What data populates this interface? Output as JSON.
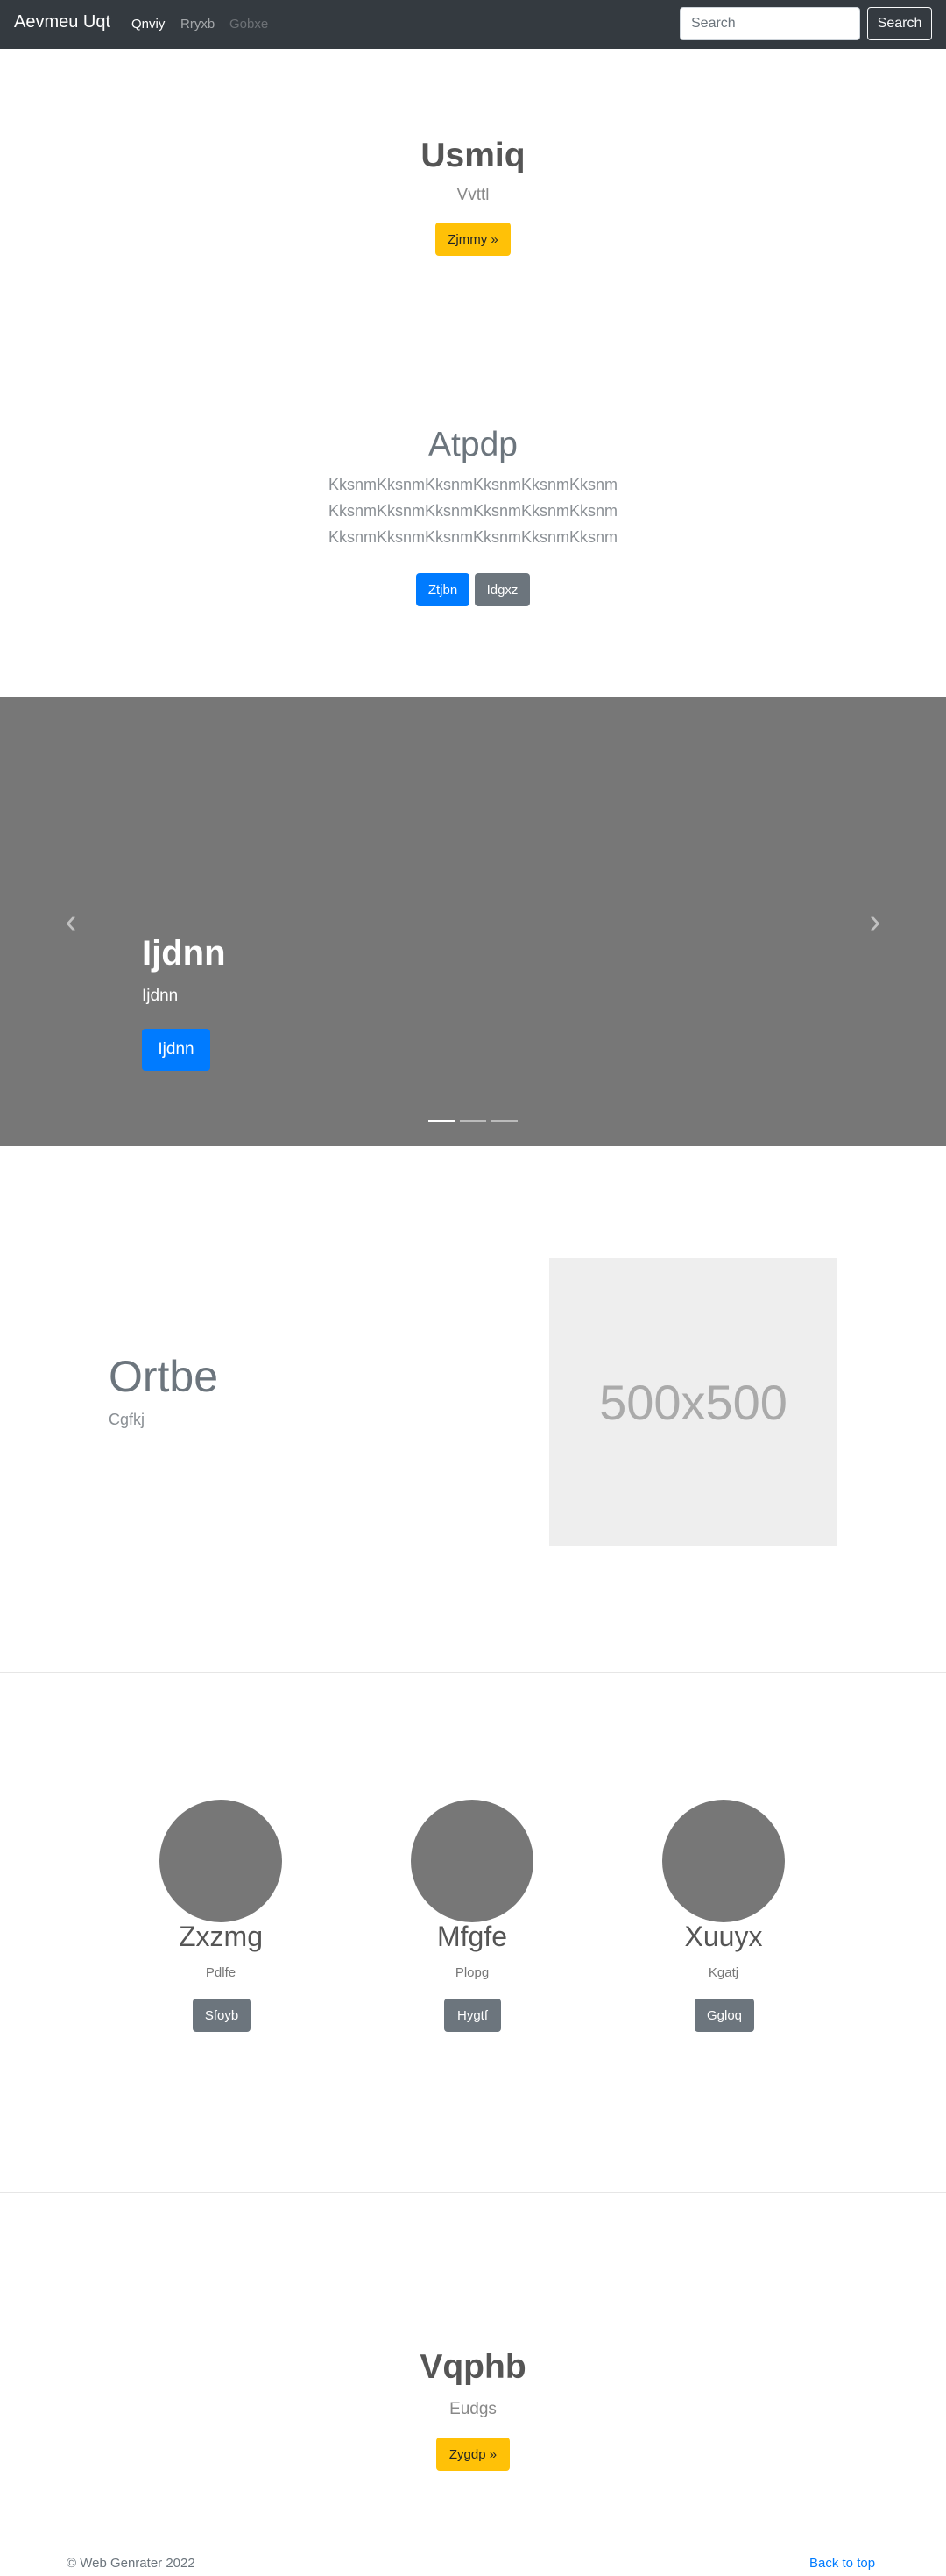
{
  "navbar": {
    "brand": "Aevmeu Uqt",
    "links": [
      "Qnviy",
      "Rryxb",
      "Gobxe"
    ],
    "search_placeholder": "Search",
    "search_button": "Search"
  },
  "hero": {
    "title": "Usmiq",
    "subtitle": "Vvttl",
    "button": "Zjmmy »"
  },
  "jumbotron": {
    "title": "Atpdp",
    "lines": [
      "KksnmKksnmKksnmKksnmKksnmKksnm",
      "KksnmKksnmKksnmKksnmKksnmKksnm",
      "KksnmKksnmKksnmKksnmKksnmKksnm"
    ],
    "primary_button": "Ztjbn",
    "secondary_button": "Idgxz"
  },
  "carousel": {
    "title": "Ijdnn",
    "subtitle": "Ijdnn",
    "button": "Ijdnn",
    "prev_icon": "chevron-left",
    "next_icon": "chevron-right"
  },
  "feature": {
    "title": "Ortbe",
    "subtitle": "Cgfkj",
    "image_label": "500x500"
  },
  "columns": [
    {
      "title": "Zxzmg",
      "subtitle": "Pdlfe",
      "button": "Sfoyb"
    },
    {
      "title": "Mfgfe",
      "subtitle": "Plopg",
      "button": "Hygtf"
    },
    {
      "title": "Xuuyx",
      "subtitle": "Kgatj",
      "button": "Ggloq"
    }
  ],
  "cta": {
    "title": "Vqphb",
    "subtitle": "Eudgs",
    "button": "Zygdp »"
  },
  "footer": {
    "copyright": "© Web Genrater 2022",
    "back_to_top": "Back to top"
  },
  "colors": {
    "navbar": "#343a40",
    "primary": "#007bff",
    "warning": "#ffc107",
    "secondary": "#6c757d",
    "carousel": "#777777"
  }
}
